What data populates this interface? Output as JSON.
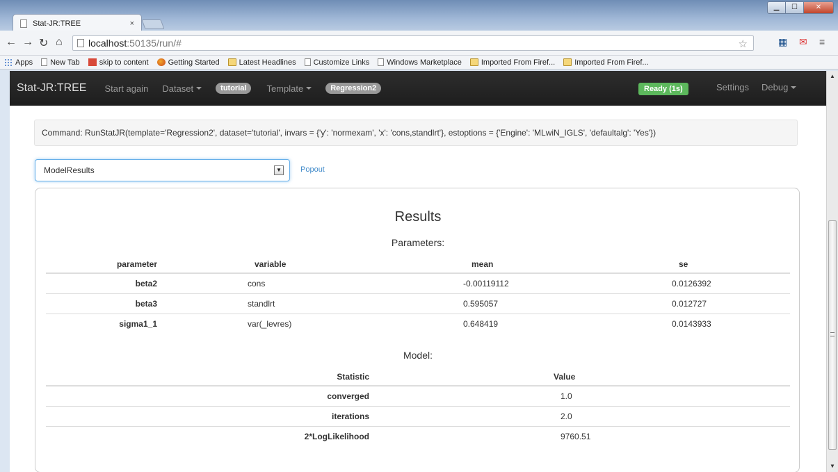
{
  "browser": {
    "tab_title": "Stat-JR:TREE",
    "tab_close": "×",
    "url_host": "localhost",
    "url_path": ":50135/run/#",
    "bookmarks": [
      {
        "label": "Apps",
        "icon": "apps-icon"
      },
      {
        "label": "New Tab",
        "icon": "page-icon"
      },
      {
        "label": "skip to content",
        "icon": "red-icon"
      },
      {
        "label": "Getting Started",
        "icon": "firefox-icon"
      },
      {
        "label": "Latest Headlines",
        "icon": "folder-icon"
      },
      {
        "label": "Customize Links",
        "icon": "page-icon"
      },
      {
        "label": "Windows Marketplace",
        "icon": "page-icon"
      },
      {
        "label": "Imported From Firef...",
        "icon": "folder-icon"
      },
      {
        "label": "Imported From Firef...",
        "icon": "folder-icon"
      }
    ]
  },
  "navbar": {
    "brand": "Stat-JR:TREE",
    "start_again": "Start again",
    "dataset": "Dataset",
    "dataset_value": "tutorial",
    "template": "Template",
    "template_value": "Regression2",
    "status": "Ready (1s)",
    "settings": "Settings",
    "debug": "Debug"
  },
  "command": "Command: RunStatJR(template='Regression2', dataset='tutorial', invars = {'y': 'normexam', 'x': 'cons,standlrt'}, estoptions = {'Engine': 'MLwiN_IGLS', 'defaultalg': 'Yes'})",
  "output_select": {
    "value": "ModelResults"
  },
  "popout": "Popout",
  "results": {
    "title": "Results",
    "parameters_title": "Parameters:",
    "param_headers": [
      "parameter",
      "variable",
      "mean",
      "se"
    ],
    "param_rows": [
      [
        "beta2",
        "cons",
        "-0.00119112",
        "0.0126392"
      ],
      [
        "beta3",
        "standlrt",
        "0.595057",
        "0.012727"
      ],
      [
        "sigma1_1",
        "var(_levres)",
        "0.648419",
        "0.0143933"
      ]
    ],
    "model_title": "Model:",
    "model_headers": [
      "Statistic",
      "Value"
    ],
    "model_rows": [
      [
        "converged",
        "1.0"
      ],
      [
        "iterations",
        "2.0"
      ],
      [
        "2*LogLikelihood",
        "9760.51"
      ]
    ]
  }
}
